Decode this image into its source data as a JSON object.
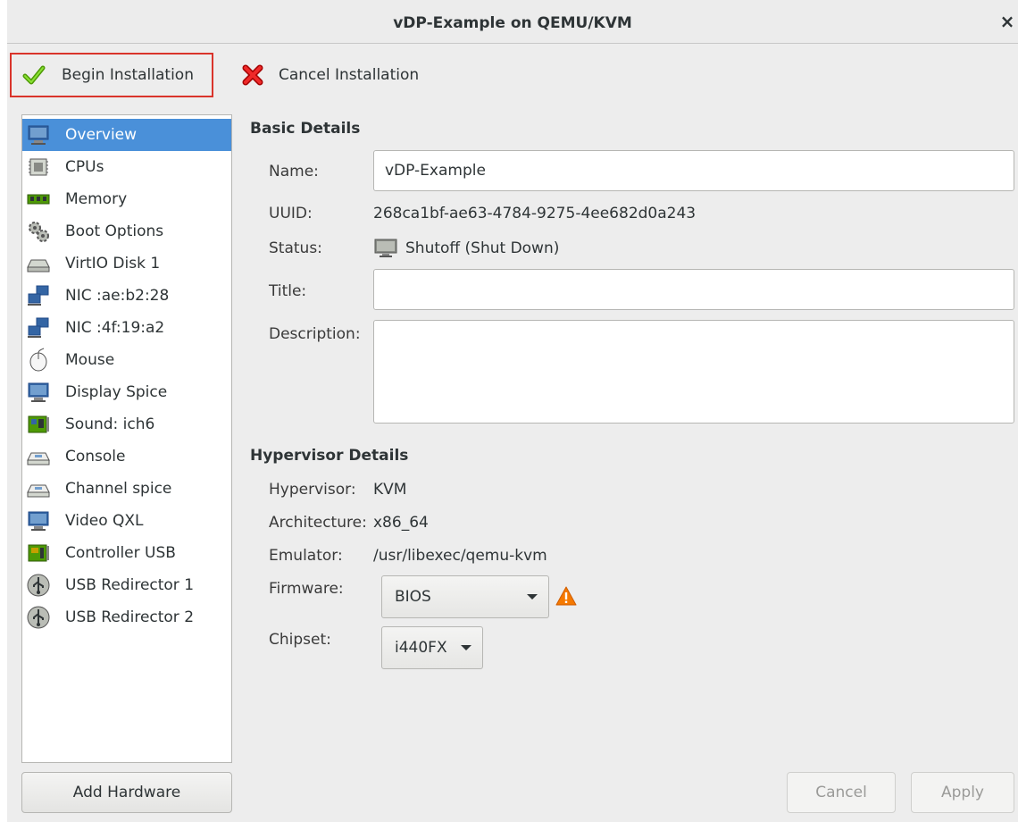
{
  "window": {
    "title": "vDP-Example on QEMU/KVM",
    "close_glyph": "×"
  },
  "toolbar": {
    "begin_label": "Begin Installation",
    "cancel_label": "Cancel Installation",
    "begin_icon": "checkmark-icon",
    "cancel_icon": "red-x-icon",
    "highlight_color": "#d9342b"
  },
  "sidebar": {
    "selected_color": "#4a90d9",
    "items": [
      {
        "label": "Overview",
        "icon": "monitor-icon"
      },
      {
        "label": "CPUs",
        "icon": "cpu-icon"
      },
      {
        "label": "Memory",
        "icon": "memory-icon"
      },
      {
        "label": "Boot Options",
        "icon": "gears-icon"
      },
      {
        "label": "VirtIO Disk 1",
        "icon": "disk-icon"
      },
      {
        "label": "NIC :ae:b2:28",
        "icon": "network-icon"
      },
      {
        "label": "NIC :4f:19:a2",
        "icon": "network-icon"
      },
      {
        "label": "Mouse",
        "icon": "mouse-icon"
      },
      {
        "label": "Display Spice",
        "icon": "display-icon"
      },
      {
        "label": "Sound: ich6",
        "icon": "sound-card-icon"
      },
      {
        "label": "Console",
        "icon": "serial-icon"
      },
      {
        "label": "Channel spice",
        "icon": "serial-icon"
      },
      {
        "label": "Video QXL",
        "icon": "display-icon"
      },
      {
        "label": "Controller USB",
        "icon": "controller-icon"
      },
      {
        "label": "USB Redirector 1",
        "icon": "usb-icon"
      },
      {
        "label": "USB Redirector 2",
        "icon": "usb-icon"
      }
    ],
    "add_hardware_label": "Add Hardware"
  },
  "basic_details": {
    "section_title": "Basic Details",
    "name_label": "Name:",
    "name_value": "vDP-Example",
    "uuid_label": "UUID:",
    "uuid_value": "268ca1bf-ae63-4784-9275-4ee682d0a243",
    "status_label": "Status:",
    "status_value": "Shutoff (Shut Down)",
    "title_label": "Title:",
    "title_value": "",
    "description_label": "Description:",
    "description_value": ""
  },
  "hypervisor_details": {
    "section_title": "Hypervisor Details",
    "hypervisor_label": "Hypervisor:",
    "hypervisor_value": "KVM",
    "architecture_label": "Architecture:",
    "architecture_value": "x86_64",
    "emulator_label": "Emulator:",
    "emulator_value": "/usr/libexec/qemu-kvm",
    "firmware_label": "Firmware:",
    "firmware_value": "BIOS",
    "chipset_label": "Chipset:",
    "chipset_value": "i440FX"
  },
  "footer": {
    "cancel_label": "Cancel",
    "apply_label": "Apply"
  }
}
